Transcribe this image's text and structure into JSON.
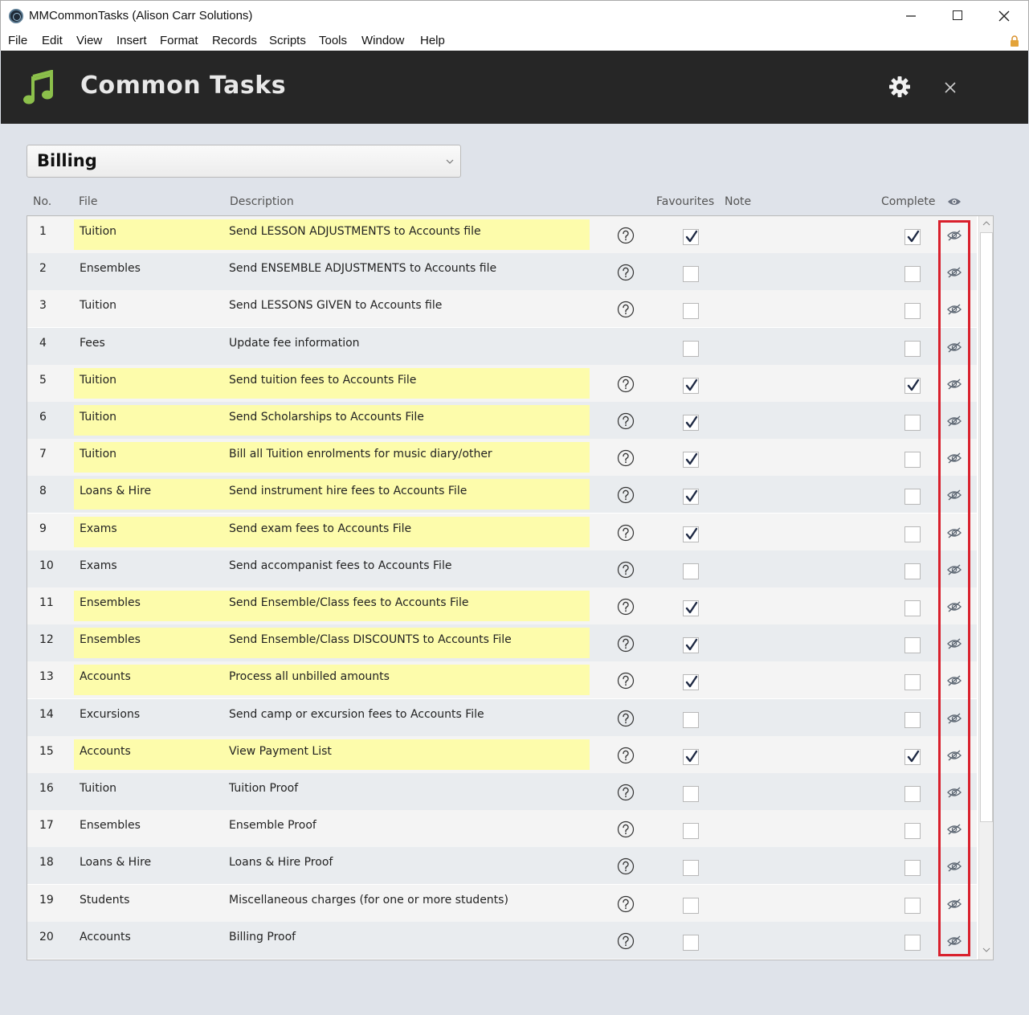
{
  "window": {
    "title": "MMCommonTasks (Alison Carr Solutions)",
    "minimize": "—",
    "close": "✕"
  },
  "menu": [
    "File",
    "Edit",
    "View",
    "Insert",
    "Format",
    "Records",
    "Scripts",
    "Tools",
    "Window",
    "Help"
  ],
  "header": {
    "title": "Common Tasks",
    "icons": [
      "music-note-icon",
      "gear-icon",
      "close-icon"
    ],
    "background": "#262626",
    "accent": "#8cc04b"
  },
  "filter": {
    "selected": "Billing"
  },
  "columns": {
    "no": "No.",
    "file": "File",
    "description": "Description",
    "favourites": "Favourites",
    "note": "Note",
    "complete": "Complete"
  },
  "highlight_color": "#fdfcab",
  "rows": [
    {
      "no": "1",
      "file": "Tuition",
      "description": "Send LESSON ADJUSTMENTS to Accounts file",
      "help": true,
      "favourite": true,
      "complete": true,
      "highlighted": true
    },
    {
      "no": "2",
      "file": "Ensembles",
      "description": "Send ENSEMBLE ADJUSTMENTS to Accounts file",
      "help": true,
      "favourite": false,
      "complete": false,
      "highlighted": false
    },
    {
      "no": "3",
      "file": "Tuition",
      "description": "Send LESSONS GIVEN to Accounts file",
      "help": true,
      "favourite": false,
      "complete": false,
      "highlighted": false
    },
    {
      "no": "4",
      "file": "Fees",
      "description": "Update fee information",
      "help": false,
      "favourite": false,
      "complete": false,
      "highlighted": false
    },
    {
      "no": "5",
      "file": "Tuition",
      "description": "Send tuition fees to Accounts File",
      "help": true,
      "favourite": true,
      "complete": true,
      "highlighted": true
    },
    {
      "no": "6",
      "file": "Tuition",
      "description": "Send Scholarships to Accounts File",
      "help": true,
      "favourite": true,
      "complete": false,
      "highlighted": true
    },
    {
      "no": "7",
      "file": "Tuition",
      "description": "Bill all Tuition enrolments for music diary/other",
      "help": true,
      "favourite": true,
      "complete": false,
      "highlighted": true
    },
    {
      "no": "8",
      "file": "Loans & Hire",
      "description": "Send instrument hire fees to Accounts File",
      "help": true,
      "favourite": true,
      "complete": false,
      "highlighted": true
    },
    {
      "no": "9",
      "file": "Exams",
      "description": "Send exam fees to Accounts File",
      "help": true,
      "favourite": true,
      "complete": false,
      "highlighted": true
    },
    {
      "no": "10",
      "file": "Exams",
      "description": "Send accompanist fees to Accounts File",
      "help": true,
      "favourite": false,
      "complete": false,
      "highlighted": false
    },
    {
      "no": "11",
      "file": "Ensembles",
      "description": "Send Ensemble/Class fees to Accounts File",
      "help": true,
      "favourite": true,
      "complete": false,
      "highlighted": true
    },
    {
      "no": "12",
      "file": "Ensembles",
      "description": "Send Ensemble/Class DISCOUNTS to Accounts File",
      "help": true,
      "favourite": true,
      "complete": false,
      "highlighted": true
    },
    {
      "no": "13",
      "file": "Accounts",
      "description": "Process all unbilled amounts",
      "help": true,
      "favourite": true,
      "complete": false,
      "highlighted": true
    },
    {
      "no": "14",
      "file": "Excursions",
      "description": "Send camp or excursion fees to Accounts File",
      "help": true,
      "favourite": false,
      "complete": false,
      "highlighted": false
    },
    {
      "no": "15",
      "file": "Accounts",
      "description": "View Payment List",
      "help": true,
      "favourite": true,
      "complete": true,
      "highlighted": true
    },
    {
      "no": "16",
      "file": "Tuition",
      "description": "Tuition Proof",
      "help": true,
      "favourite": false,
      "complete": false,
      "highlighted": false
    },
    {
      "no": "17",
      "file": "Ensembles",
      "description": "Ensemble Proof",
      "help": true,
      "favourite": false,
      "complete": false,
      "highlighted": false
    },
    {
      "no": "18",
      "file": "Loans & Hire",
      "description": "Loans & Hire Proof",
      "help": true,
      "favourite": false,
      "complete": false,
      "highlighted": false
    },
    {
      "no": "19",
      "file": "Students",
      "description": "Miscellaneous charges (for one or more students)",
      "help": true,
      "favourite": false,
      "complete": false,
      "highlighted": false
    },
    {
      "no": "20",
      "file": "Accounts",
      "description": "Billing Proof",
      "help": true,
      "favourite": false,
      "complete": false,
      "highlighted": false
    }
  ]
}
